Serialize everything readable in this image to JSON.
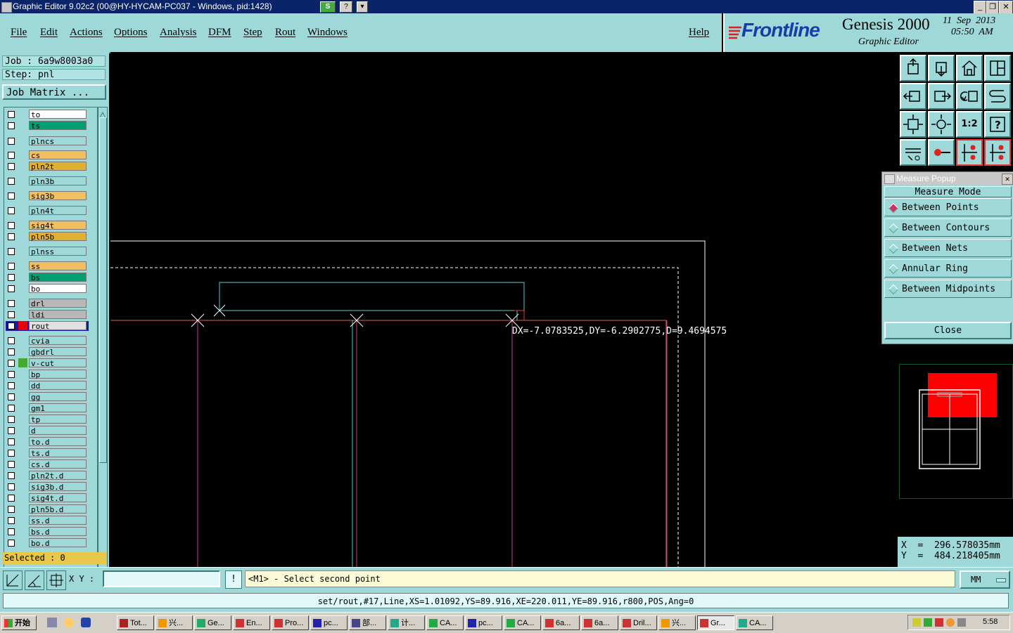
{
  "window": {
    "title": "Graphic Editor 9.02c2 (00@HY-HYCAM-PC037 - Windows, pid:1428)",
    "badge_s": "S",
    "badge_q": "?",
    "min_glyph": "_",
    "max_glyph": "❐",
    "close_glyph": "✕"
  },
  "menu": {
    "file": "File",
    "edit": "Edit",
    "actions": "Actions",
    "options": "Options",
    "analysis": "Analysis",
    "dfm": "DFM",
    "step": "Step",
    "rout": "Rout",
    "windows": "Windows",
    "help": "Help"
  },
  "logo": {
    "brand": "Frontline",
    "product": "Genesis 2000",
    "subtitle": "Graphic Editor",
    "date": "11  Sep  2013",
    "time": "05:50  AM"
  },
  "job": {
    "job_label": "Job  :  6a9w8003a0",
    "step_label": "Step:  pnl",
    "matrix_button": "Job Matrix ..."
  },
  "layers": [
    {
      "name": "to",
      "color": "#ffffff"
    },
    {
      "name": "ts",
      "color": "#00a070"
    },
    {
      "name": "plncs",
      "color": "#9ed8d8"
    },
    {
      "name": "cs",
      "color": "#f0c060"
    },
    {
      "name": "pln2t",
      "color": "#e0b030"
    },
    {
      "name": "pln3b",
      "color": "#9ed8d8"
    },
    {
      "name": "sig3b",
      "color": "#f0c060"
    },
    {
      "name": "pln4t",
      "color": "#9ed8d8"
    },
    {
      "name": "sig4t",
      "color": "#f0c060"
    },
    {
      "name": "pln5b",
      "color": "#e0b030"
    },
    {
      "name": "plnss",
      "color": "#9ed8d8"
    },
    {
      "name": "ss",
      "color": "#f0c060"
    },
    {
      "name": "bs",
      "color": "#00a070"
    },
    {
      "name": "bo",
      "color": "#ffffff"
    },
    {
      "name": "drl",
      "color": "#b8b8b8"
    },
    {
      "name": "ldi",
      "color": "#b8b8b8"
    },
    {
      "name": "rout",
      "color": "#e0e0e0"
    },
    {
      "name": "cvia",
      "color": "#9ed8d8"
    },
    {
      "name": "gbdrl",
      "color": "#9ed8d8"
    },
    {
      "name": "v-cut",
      "color": "#9ed8d8"
    },
    {
      "name": "bp",
      "color": "#9ed8d8"
    },
    {
      "name": "dd",
      "color": "#9ed8d8"
    },
    {
      "name": "gg",
      "color": "#9ed8d8"
    },
    {
      "name": "gm1",
      "color": "#9ed8d8"
    },
    {
      "name": "tp",
      "color": "#9ed8d8"
    },
    {
      "name": "d",
      "color": "#9ed8d8"
    },
    {
      "name": "to.d",
      "color": "#9ed8d8"
    },
    {
      "name": "ts.d",
      "color": "#9ed8d8"
    },
    {
      "name": "cs.d",
      "color": "#9ed8d8"
    },
    {
      "name": "pln2t.d",
      "color": "#9ed8d8"
    },
    {
      "name": "sig3b.d",
      "color": "#9ed8d8"
    },
    {
      "name": "sig4t.d",
      "color": "#9ed8d8"
    },
    {
      "name": "pln5b.d",
      "color": "#9ed8d8"
    },
    {
      "name": "ss.d",
      "color": "#9ed8d8"
    },
    {
      "name": "bs.d",
      "color": "#9ed8d8"
    },
    {
      "name": "bo.d",
      "color": "#9ed8d8"
    }
  ],
  "selected_label": "Selected : 0",
  "canvas": {
    "measure_text": "DX=-7.0783525,DY=-6.2902775,D=9.4694575"
  },
  "measure_popup": {
    "title": "Measure Popup",
    "heading": "Measure Mode",
    "options": [
      "Between Points",
      "Between Contours",
      "Between Nets",
      "Annular Ring",
      "Between Midpoints"
    ],
    "selected": "Between Points",
    "close": "Close"
  },
  "coords": {
    "x": "X  =  296.578035mm",
    "y": "Y  =  484.218405mm"
  },
  "bottom": {
    "xy_label": "X Y :",
    "xy_value": "",
    "prompt": "<M1> - Select second point",
    "units": "MM",
    "command": "set/rout,#17,Line,XS=1.01092,YS=89.916,XE=220.011,YE=89.916,r800,POS,Ang=0"
  },
  "taskbar": {
    "start": "开始",
    "tasks": [
      "Tot...",
      "兴...",
      "Ge...",
      "En...",
      "Pro...",
      "pc...",
      "部...",
      "计...",
      "CA...",
      "pc...",
      "CA...",
      "6a...",
      "6a...",
      "Dril...",
      "兴...",
      "Gr...",
      "CA..."
    ],
    "clock": "5:58"
  }
}
